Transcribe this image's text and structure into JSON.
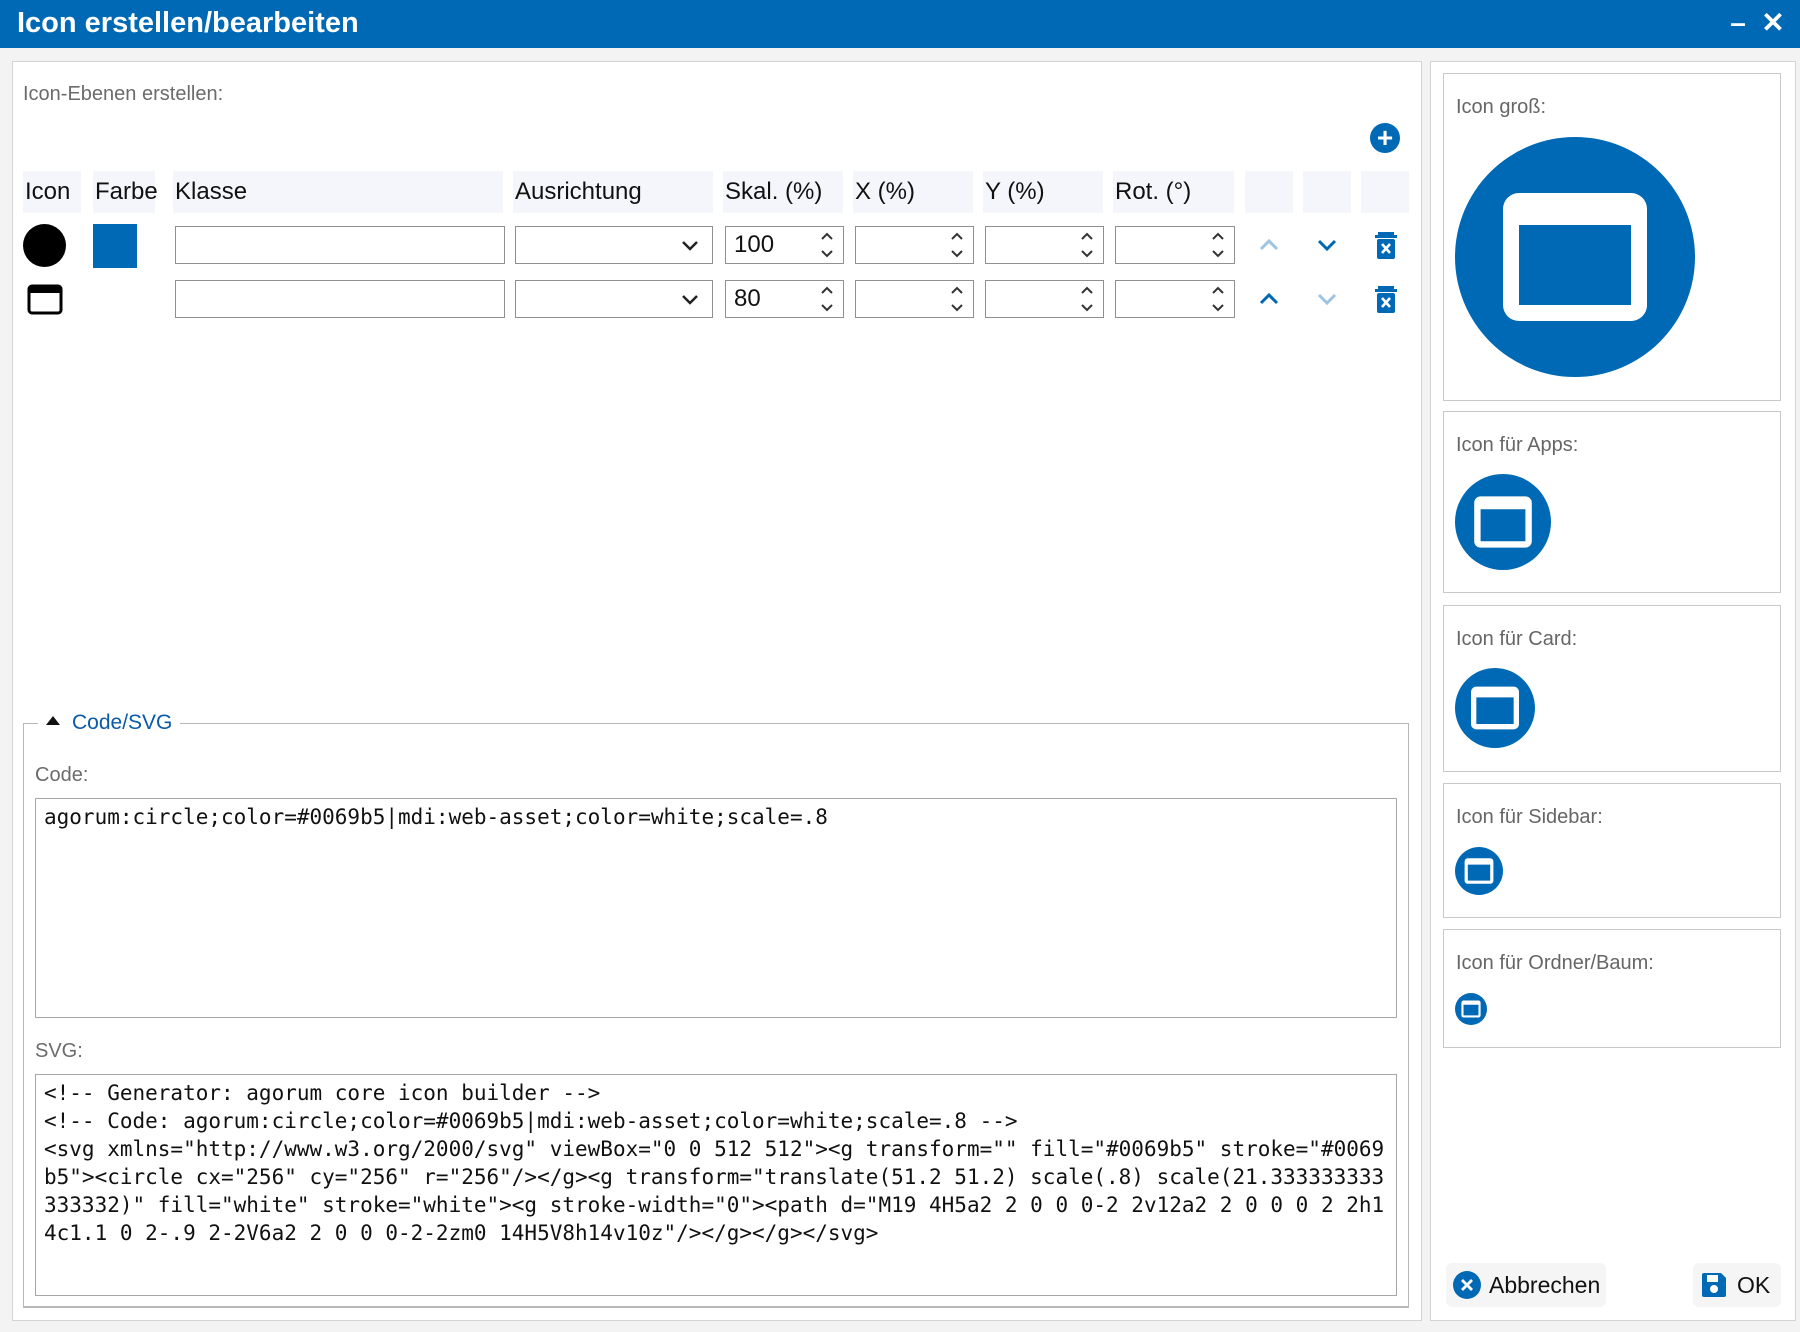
{
  "window": {
    "title": "Icon erstellen/bearbeiten",
    "minimize_glyph": "–",
    "close_glyph": "✕",
    "accent_color": "#0069b5"
  },
  "layers": {
    "section_label": "Icon-Ebenen erstellen:",
    "add_button_glyph": "+",
    "columns": {
      "icon": "Icon",
      "farbe": "Farbe",
      "klasse": "Klasse",
      "ausrichtung": "Ausrichtung",
      "skal": "Skal. (%)",
      "x": "X (%)",
      "y": "Y (%)",
      "rot": "Rot. (°)"
    },
    "rows": [
      {
        "icon": "circle-icon",
        "color": "#0069b5",
        "klasse": "",
        "ausrichtung": "",
        "skal": "100",
        "x": "",
        "y": "",
        "rot": "",
        "up_enabled": false,
        "down_enabled": true
      },
      {
        "icon": "web-asset-icon",
        "color": "",
        "klasse": "",
        "ausrichtung": "",
        "skal": "80",
        "x": "",
        "y": "",
        "rot": "",
        "up_enabled": true,
        "down_enabled": false
      }
    ]
  },
  "code_section": {
    "legend": "Code/SVG",
    "code_label": "Code:",
    "code_value": "agorum:circle;color=#0069b5|mdi:web-asset;color=white;scale=.8",
    "svg_label": "SVG:",
    "svg_value": "<!-- Generator: agorum core icon builder -->\n<!-- Code: agorum:circle;color=#0069b5|mdi:web-asset;color=white;scale=.8 -->\n<svg xmlns=\"http://www.w3.org/2000/svg\" viewBox=\"0 0 512 512\"><g transform=\"\" fill=\"#0069b5\" stroke=\"#0069b5\"><circle cx=\"256\" cy=\"256\" r=\"256\"/></g><g transform=\"translate(51.2 51.2) scale(.8) scale(21.333333333333332)\" fill=\"white\" stroke=\"white\"><g stroke-width=\"0\"><path d=\"M19 4H5a2 2 0 0 0-2 2v12a2 2 0 0 0 2 2h14c1.1 0 2-.9 2-2V6a2 2 0 0 0-2-2zm0 14H5V8h14v10z\"/></g></g></svg>"
  },
  "previews": {
    "large": "Icon groß:",
    "apps": "Icon für Apps:",
    "card": "Icon für Card:",
    "sidebar": "Icon für Sidebar:",
    "folder": "Icon für Ordner/Baum:"
  },
  "footer": {
    "cancel_label": "Abbrechen",
    "ok_label": "OK"
  }
}
